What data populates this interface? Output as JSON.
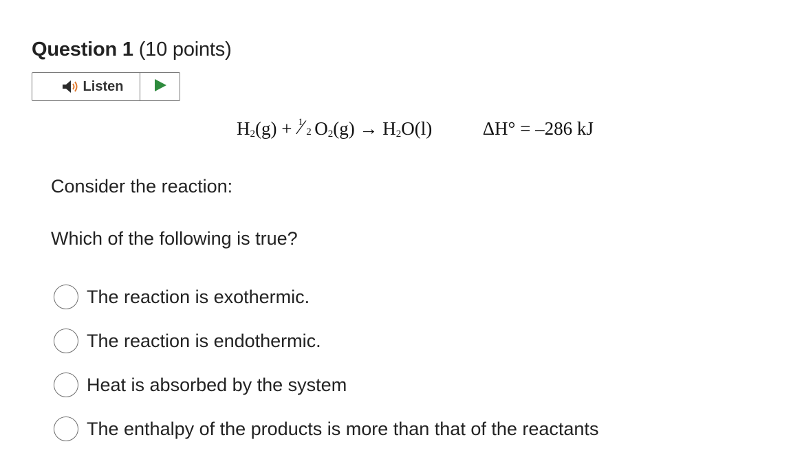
{
  "question": {
    "number_label": "Question 1",
    "points_label": "(10 points)"
  },
  "listen": {
    "label": "Listen",
    "speaker_icon": "speaker-icon",
    "play_icon": "play-icon",
    "colors": {
      "speaker": "#2b2b2b",
      "sound_waves": "#e07a2f",
      "play": "#2e8b3d"
    }
  },
  "equation": {
    "h2": "H",
    "h2_sub": "2",
    "h2_state": "(g)",
    "plus": "+",
    "frac_num": "1",
    "frac_slash": "⁄",
    "frac_den": "2",
    "o2": "O",
    "o2_sub": "2",
    "o2_state": "(g)",
    "arrow": "→",
    "h2o_h": "H",
    "h2o_sub": "2",
    "h2o_o": "O",
    "h2o_state": "(l)",
    "delta_h": "ΔH° = –286 kJ"
  },
  "prompts": {
    "consider": "Consider the reaction:",
    "which": "Which of the following is true?"
  },
  "options": [
    {
      "label": "The reaction is exothermic."
    },
    {
      "label": "The reaction is endothermic."
    },
    {
      "label": "Heat is absorbed by the system"
    },
    {
      "label": "The enthalpy of the products is more than that of the reactants"
    }
  ]
}
